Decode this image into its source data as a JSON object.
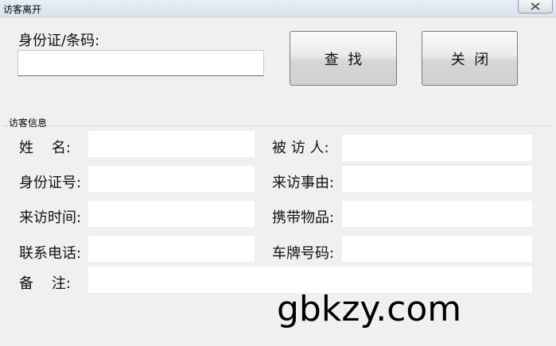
{
  "window": {
    "title": "访客离开"
  },
  "search": {
    "label": "身份证/条码:",
    "value": "",
    "find_button": "查  找",
    "close_button": "关  闭"
  },
  "group": {
    "title": "访客信息"
  },
  "fields": {
    "name_label": "姓    名:",
    "visitee_label": "被 访 人:",
    "id_label": "身份证号:",
    "reason_label": "来访事由:",
    "time_label": "来访时间:",
    "items_label": "携带物品:",
    "phone_label": "联系电话:",
    "plate_label": "车牌号码:",
    "remark_label": "备    注:"
  },
  "watermark": "gbkzy.com"
}
